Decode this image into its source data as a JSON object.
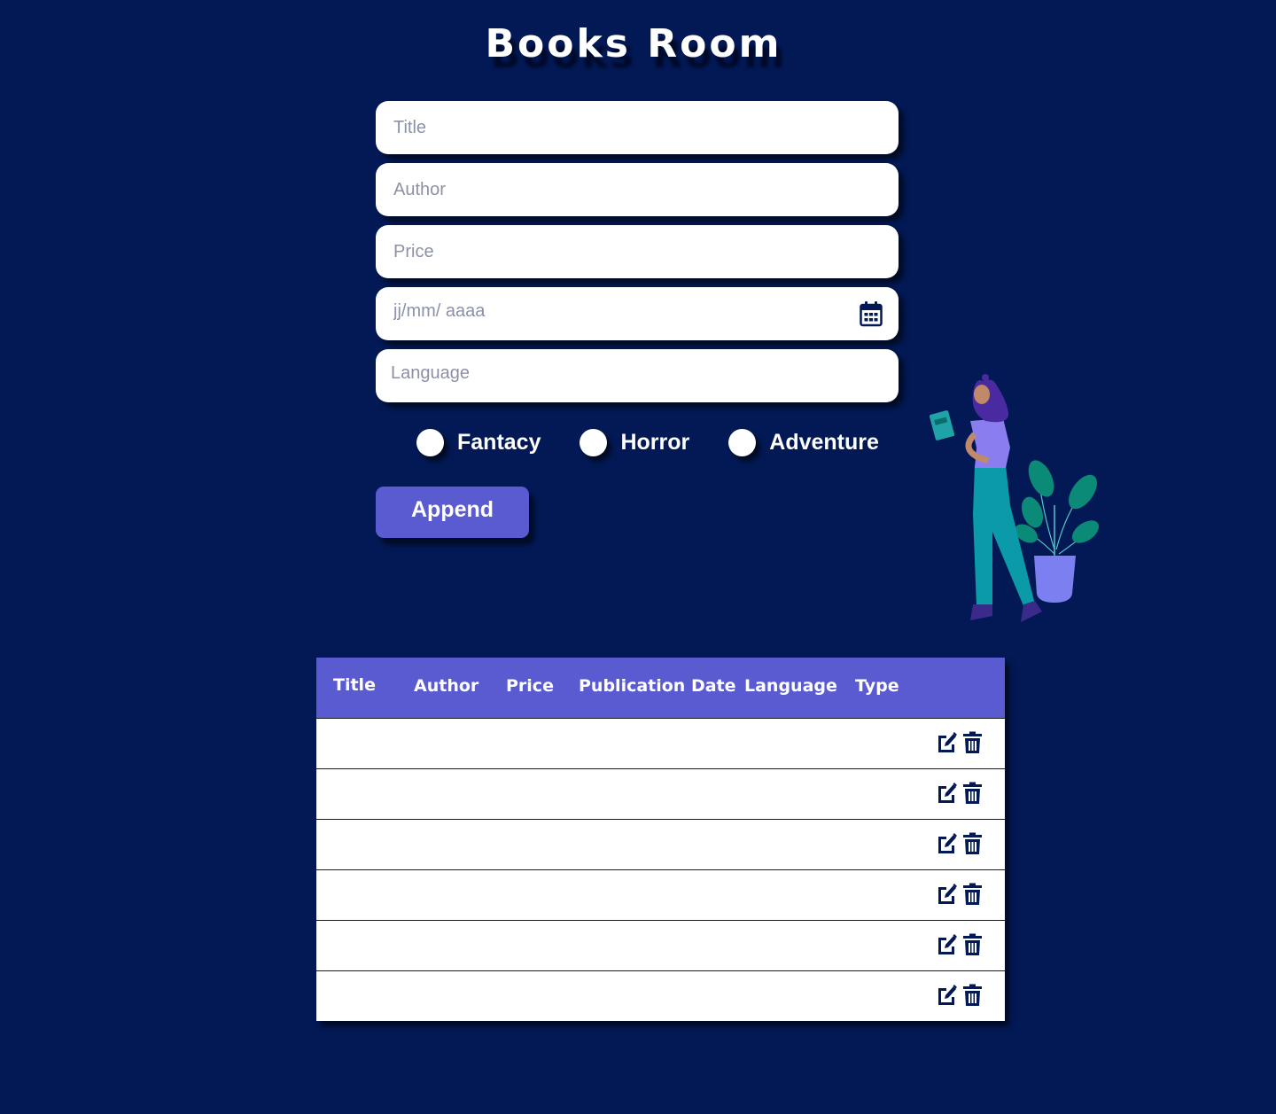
{
  "app": {
    "title": "Books Room"
  },
  "form": {
    "title_placeholder": "Title",
    "author_placeholder": "Author",
    "price_placeholder": "Price",
    "date_placeholder": "jj/mm/ aaaa",
    "language_placeholder": "Language",
    "types": [
      "Fantacy",
      "Horror",
      "Adventure"
    ],
    "append_label": "Append"
  },
  "table": {
    "columns": [
      "Title",
      "Author",
      "Price",
      "Publication Date",
      "Language",
      "Type"
    ],
    "rows": [
      {
        "actions": [
          "edit-icon",
          "trash-icon"
        ]
      },
      {
        "actions": [
          "edit-icon",
          "trash-icon"
        ]
      },
      {
        "actions": [
          "edit-icon",
          "trash-icon"
        ]
      },
      {
        "actions": [
          "edit-icon",
          "trash-icon"
        ]
      },
      {
        "actions": [
          "edit-icon",
          "trash-icon"
        ]
      },
      {
        "actions": [
          "edit-icon",
          "trash-icon"
        ]
      }
    ]
  },
  "colors": {
    "background": "#021955",
    "accent": "#5a5bd1",
    "surface": "#ffffff"
  }
}
